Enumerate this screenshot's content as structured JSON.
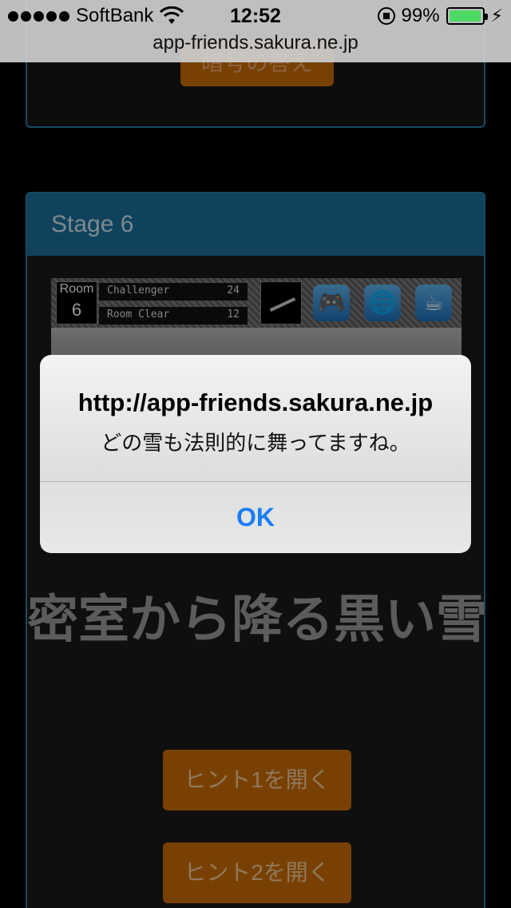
{
  "status_bar": {
    "carrier": "SoftBank",
    "time": "12:52",
    "battery": "99%",
    "battery_level": 0.99
  },
  "browser": {
    "url": "app-friends.sakura.ne.jp"
  },
  "previous_card": {
    "button_label": "暗号の答え"
  },
  "stage_card": {
    "header": "Stage 6",
    "game": {
      "room_label": "Room",
      "room_number": "6",
      "challenger_label": "Challenger",
      "challenger_value": "24",
      "room_clear_label": "Room Clear",
      "room_clear_value": "12",
      "icons": [
        "gamepad-icon",
        "globe-icon",
        "coffee-icon"
      ]
    },
    "title": "密室から降る黒い雪",
    "hint1_label": "ヒント1を開く",
    "hint2_label": "ヒント2を開く"
  },
  "alert": {
    "title": "http://app-friends.sakura.ne.jp",
    "message": "どの雪も法則的に舞ってますね。",
    "ok_label": "OK"
  },
  "colors": {
    "accent_blue": "#1c6f9c",
    "button_orange": "#c96d06",
    "alert_button": "#1a7ef2"
  }
}
